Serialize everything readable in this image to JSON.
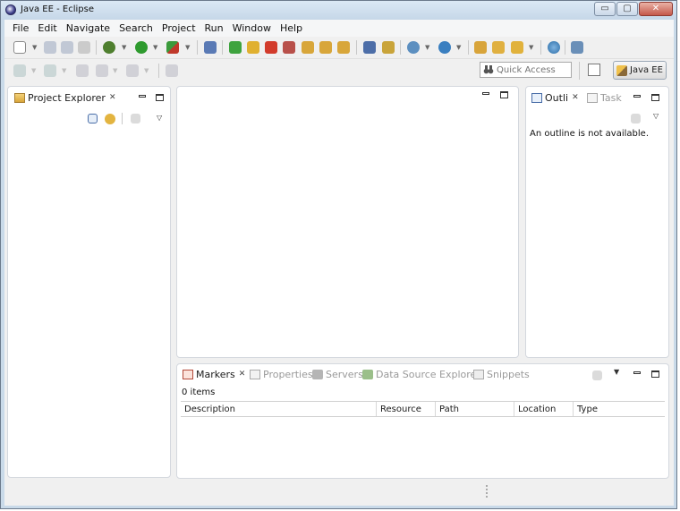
{
  "window": {
    "title": "Java EE - Eclipse",
    "controls": {
      "minimize": "▭",
      "maximize": "▢",
      "close": "✕"
    }
  },
  "menu": [
    {
      "label": "File"
    },
    {
      "label": "Edit"
    },
    {
      "label": "Navigate"
    },
    {
      "label": "Search"
    },
    {
      "label": "Project"
    },
    {
      "label": "Run"
    },
    {
      "label": "Window"
    },
    {
      "label": "Help"
    }
  ],
  "toolbar": {
    "quick_access_placeholder": "Quick Access",
    "perspective_label": "Java EE"
  },
  "project_explorer": {
    "tab_label": "Project Explorer",
    "close_glyph": "✕"
  },
  "outline_view": {
    "tabs": [
      {
        "label": "Outli",
        "active": true
      },
      {
        "label": "Task",
        "active": false
      }
    ],
    "close_glyph": "✕",
    "message": "An outline is not available."
  },
  "bottom_panel": {
    "tabs": [
      {
        "label": "Markers",
        "active": true
      },
      {
        "label": "Properties",
        "active": false
      },
      {
        "label": "Servers",
        "active": false
      },
      {
        "label": "Data Source Explorer",
        "active": false
      },
      {
        "label": "Snippets",
        "active": false
      }
    ],
    "close_glyph": "✕",
    "items_count": "0 items",
    "columns": [
      "Description",
      "Resource",
      "Path",
      "Location",
      "Type"
    ]
  },
  "colors": {
    "window_frame": "#c9dae9",
    "workbench": "#f0f0f0",
    "panel": "#ffffff"
  }
}
